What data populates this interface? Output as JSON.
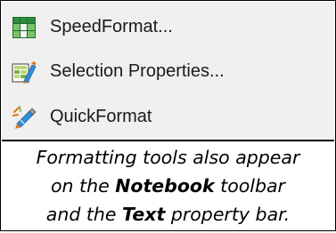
{
  "menu": {
    "items": [
      {
        "label": "SpeedFormat...",
        "icon": "speedformat-grid-icon"
      },
      {
        "label": "Selection Properties...",
        "icon": "selection-properties-icon"
      },
      {
        "label": "QuickFormat",
        "icon": "quickformat-brush-icon"
      }
    ]
  },
  "caption": {
    "line1": "Formatting tools also appear",
    "line2_prefix": "on the ",
    "line2_bold": "Notebook",
    "line2_suffix": " toolbar",
    "line3_prefix": "and the ",
    "line3_bold": "Text",
    "line3_suffix": " property bar."
  },
  "colors": {
    "menu_background": "#f0f0f0",
    "grid_dark_green": "#1e6b2e",
    "grid_light_green": "#7cc26a",
    "brush_blue": "#2f8fd8",
    "brush_orange": "#e07a1f"
  }
}
